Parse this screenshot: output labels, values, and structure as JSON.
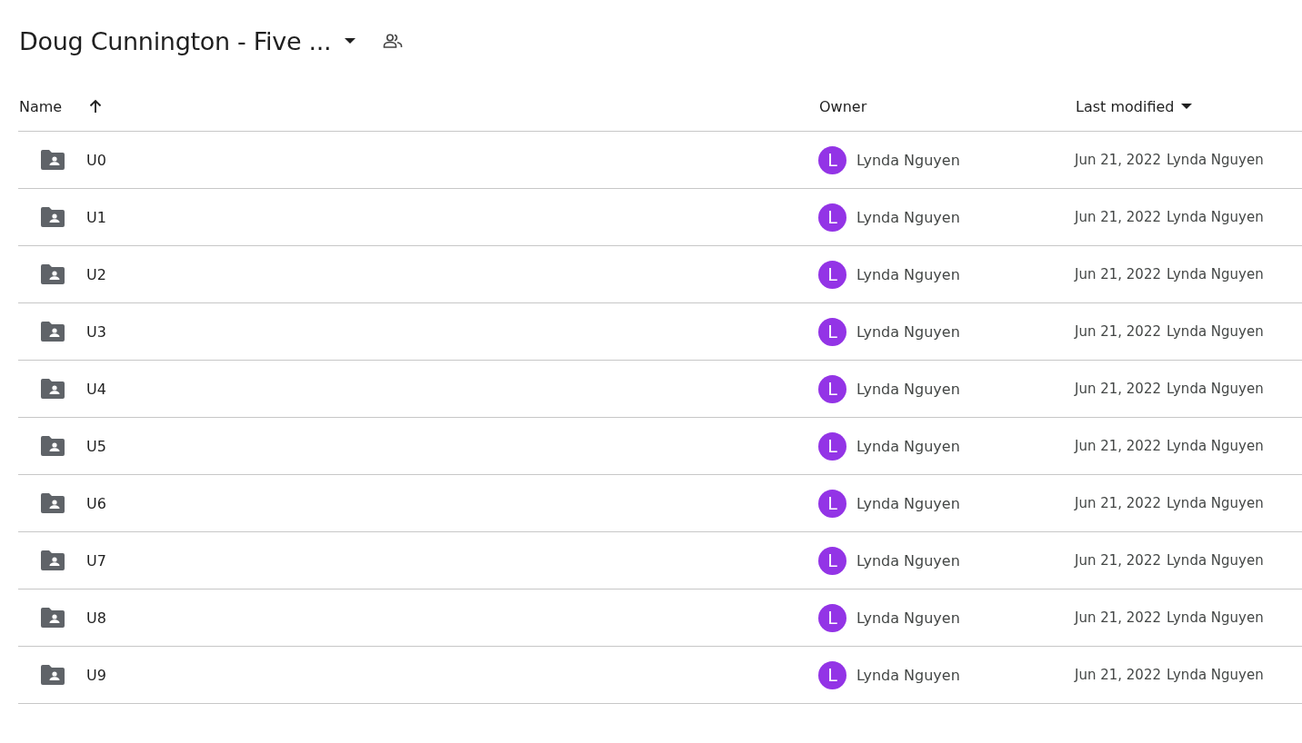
{
  "header": {
    "title": "Doug Cunnington - Five ..."
  },
  "table": {
    "columns": [
      {
        "label": "Name",
        "sorted": true,
        "has_menu": false
      },
      {
        "label": "Owner",
        "sorted": false,
        "has_menu": false
      },
      {
        "label": "Last modified",
        "sorted": false,
        "has_menu": true
      }
    ],
    "rows": [
      {
        "name": "U0",
        "owner_initial": "L",
        "owner": "Lynda Nguyen",
        "modified_date": "Jun 21, 2022",
        "modified_by": "Lynda Nguyen"
      },
      {
        "name": "U1",
        "owner_initial": "L",
        "owner": "Lynda Nguyen",
        "modified_date": "Jun 21, 2022",
        "modified_by": "Lynda Nguyen"
      },
      {
        "name": "U2",
        "owner_initial": "L",
        "owner": "Lynda Nguyen",
        "modified_date": "Jun 21, 2022",
        "modified_by": "Lynda Nguyen"
      },
      {
        "name": "U3",
        "owner_initial": "L",
        "owner": "Lynda Nguyen",
        "modified_date": "Jun 21, 2022",
        "modified_by": "Lynda Nguyen"
      },
      {
        "name": "U4",
        "owner_initial": "L",
        "owner": "Lynda Nguyen",
        "modified_date": "Jun 21, 2022",
        "modified_by": "Lynda Nguyen"
      },
      {
        "name": "U5",
        "owner_initial": "L",
        "owner": "Lynda Nguyen",
        "modified_date": "Jun 21, 2022",
        "modified_by": "Lynda Nguyen"
      },
      {
        "name": "U6",
        "owner_initial": "L",
        "owner": "Lynda Nguyen",
        "modified_date": "Jun 21, 2022",
        "modified_by": "Lynda Nguyen"
      },
      {
        "name": "U7",
        "owner_initial": "L",
        "owner": "Lynda Nguyen",
        "modified_date": "Jun 21, 2022",
        "modified_by": "Lynda Nguyen"
      },
      {
        "name": "U8",
        "owner_initial": "L",
        "owner": "Lynda Nguyen",
        "modified_date": "Jun 21, 2022",
        "modified_by": "Lynda Nguyen"
      },
      {
        "name": "U9",
        "owner_initial": "L",
        "owner": "Lynda Nguyen",
        "modified_date": "Jun 21, 2022",
        "modified_by": "Lynda Nguyen"
      }
    ]
  }
}
